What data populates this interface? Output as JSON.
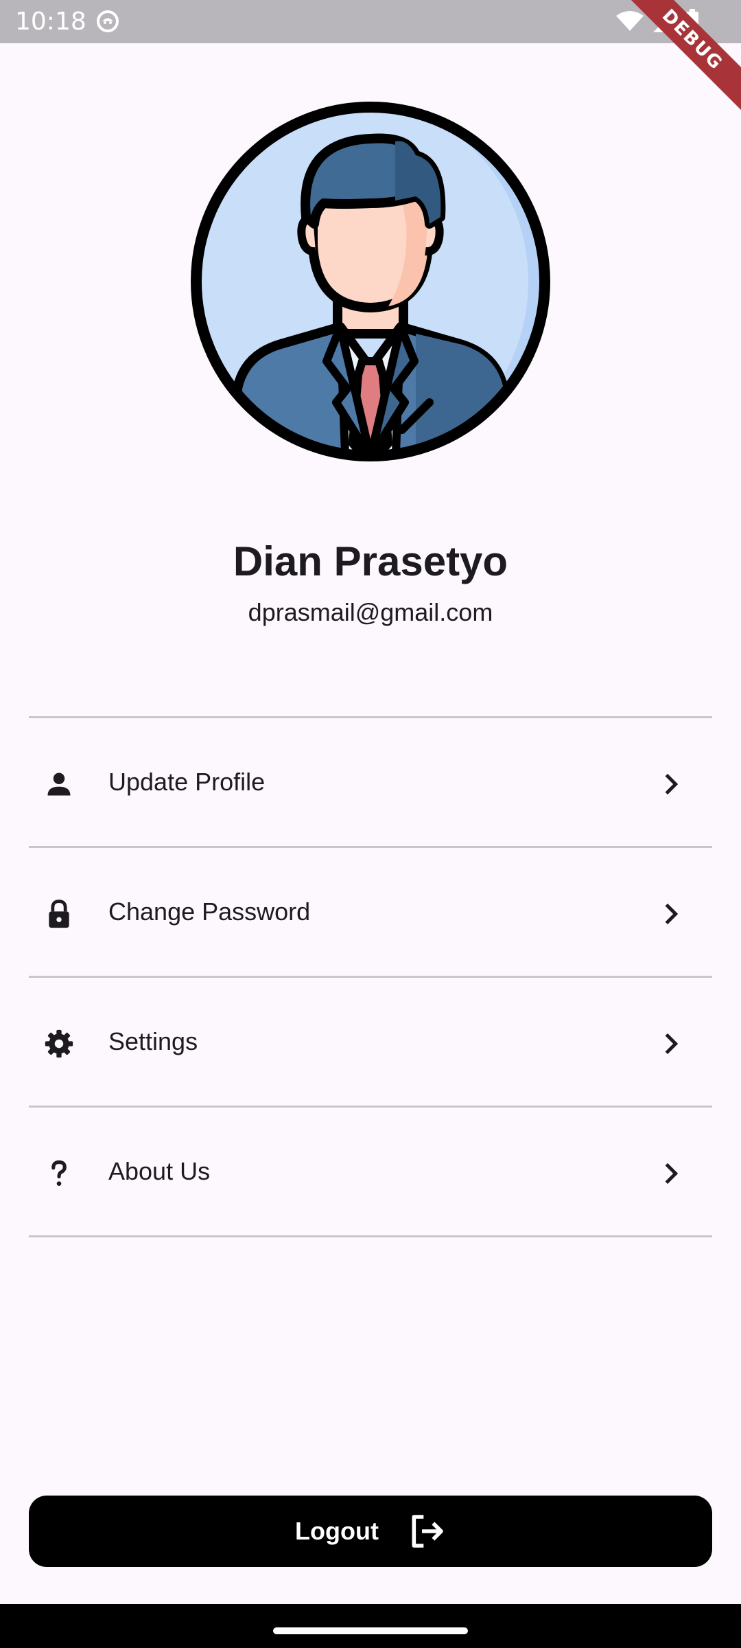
{
  "status_bar": {
    "time": "10:18",
    "debug_label": "DEBUG",
    "icons": [
      "wifi-icon",
      "cell-signal-icon",
      "battery-icon"
    ],
    "background": "#b9b6bb"
  },
  "profile": {
    "name": "Dian Prasetyo",
    "email": "dprasmail@gmail.com",
    "avatar_icon": "businessman-avatar-icon"
  },
  "menu": {
    "items": [
      {
        "label": "Update Profile",
        "icon": "person-icon"
      },
      {
        "label": "Change Password",
        "icon": "lock-icon"
      },
      {
        "label": "Settings",
        "icon": "gear-icon"
      },
      {
        "label": "About Us",
        "icon": "question-mark-icon"
      }
    ],
    "chevron_icon": "chevron-right-icon"
  },
  "logout": {
    "label": "Logout",
    "icon": "logout-icon",
    "background": "#000000"
  },
  "colors": {
    "page_background": "#fdf7fe",
    "text": "#1d1b20",
    "divider": "#cac4cf",
    "debug_ribbon": "#a8343a"
  }
}
